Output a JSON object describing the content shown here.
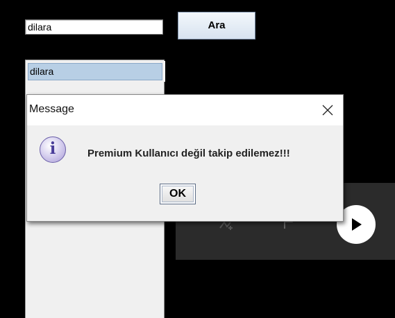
{
  "search": {
    "value": "dilara",
    "button_label": "Ara"
  },
  "results": {
    "items": [
      {
        "label": "dilara"
      }
    ]
  },
  "dialog": {
    "title": "Message",
    "message": "Premium Kullanıcı değil takip edilemez!!!",
    "ok_label": "OK",
    "icon": "info-icon"
  },
  "player": {
    "icons": [
      "shuffle-icon",
      "flag-icon",
      "play-icon"
    ],
    "panel_color": "#2b2b2b"
  },
  "colors": {
    "background": "#000000",
    "selection": "#b8cfe5"
  }
}
